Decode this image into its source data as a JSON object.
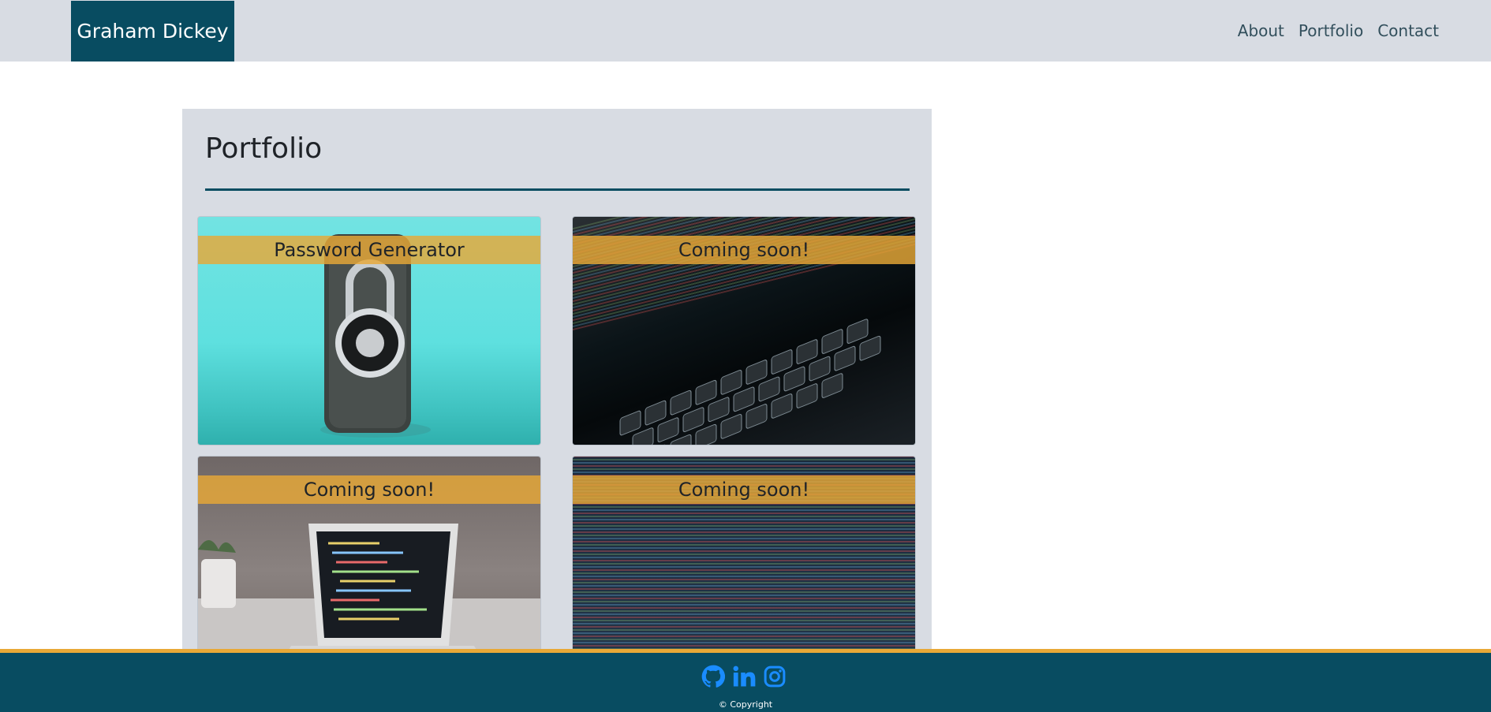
{
  "header": {
    "brand": "Graham Dickey",
    "nav": [
      "About",
      "Portfolio",
      "Contact"
    ]
  },
  "portfolio": {
    "title": "Portfolio",
    "cards": [
      {
        "label": "Password Generator"
      },
      {
        "label": "Coming soon!"
      },
      {
        "label": "Coming soon!"
      },
      {
        "label": "Coming soon!"
      }
    ]
  },
  "footer": {
    "social": [
      "github-icon",
      "linkedin-icon",
      "instagram-icon"
    ],
    "copyright": "© Copyright"
  },
  "colors": {
    "primary": "#084c61",
    "accent": "#e8a837",
    "header_bg": "#d8dce3",
    "social_icon": "#1a8cff"
  }
}
